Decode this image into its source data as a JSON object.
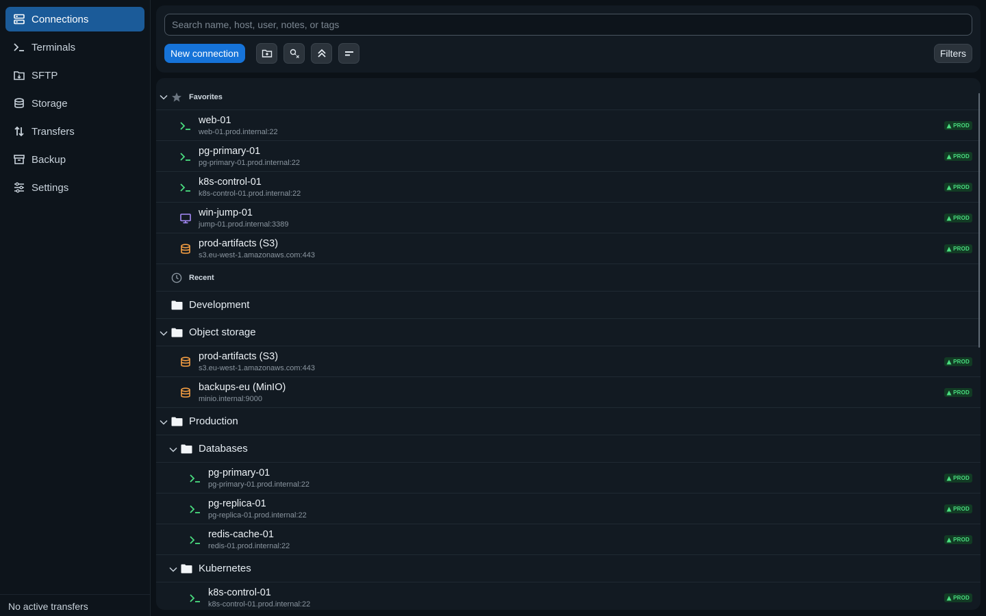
{
  "sidebar": {
    "items": [
      {
        "label": "Connections",
        "icon": "connections-icon",
        "active": true
      },
      {
        "label": "Terminals",
        "icon": "terminal-icon"
      },
      {
        "label": "SFTP",
        "icon": "sftp-icon"
      },
      {
        "label": "Storage",
        "icon": "storage-icon"
      },
      {
        "label": "Transfers",
        "icon": "transfers-icon"
      },
      {
        "label": "Backup",
        "icon": "backup-icon"
      },
      {
        "label": "Settings",
        "icon": "settings-icon"
      }
    ],
    "footer": "No active transfers"
  },
  "toolbar": {
    "search_placeholder": "Search name, host, user, notes, or tags",
    "new_connection": "New connection",
    "filters": "Filters",
    "tools": [
      "new-folder-icon",
      "clear-key-icon",
      "collapse-all-icon",
      "sort-icon"
    ]
  },
  "sections": {
    "favorites": "Favorites",
    "recent": "Recent"
  },
  "favorites": [
    {
      "name": "web-01",
      "host": "web-01.prod.internal:22",
      "type": "ssh",
      "badge": "PROD"
    },
    {
      "name": "pg-primary-01",
      "host": "pg-primary-01.prod.internal:22",
      "type": "ssh",
      "badge": "PROD"
    },
    {
      "name": "k8s-control-01",
      "host": "k8s-control-01.prod.internal:22",
      "type": "ssh",
      "badge": "PROD"
    },
    {
      "name": "win-jump-01",
      "host": "jump-01.prod.internal:3389",
      "type": "rdp",
      "badge": "PROD"
    },
    {
      "name": "prod-artifacts (S3)",
      "host": "s3.eu-west-1.amazonaws.com:443",
      "type": "storage",
      "badge": "PROD"
    }
  ],
  "groups": {
    "development": "Development",
    "object_storage": "Object storage",
    "production": "Production",
    "databases": "Databases",
    "kubernetes": "Kubernetes"
  },
  "object_storage": [
    {
      "name": "prod-artifacts (S3)",
      "host": "s3.eu-west-1.amazonaws.com:443",
      "type": "storage",
      "badge": "PROD"
    },
    {
      "name": "backups-eu (MinIO)",
      "host": "minio.internal:9000",
      "type": "storage",
      "badge": "PROD"
    }
  ],
  "databases": [
    {
      "name": "pg-primary-01",
      "host": "pg-primary-01.prod.internal:22",
      "type": "ssh",
      "badge": "PROD"
    },
    {
      "name": "pg-replica-01",
      "host": "pg-replica-01.prod.internal:22",
      "type": "ssh",
      "badge": "PROD"
    },
    {
      "name": "redis-cache-01",
      "host": "redis-01.prod.internal:22",
      "type": "ssh",
      "badge": "PROD"
    }
  ],
  "kubernetes": [
    {
      "name": "k8s-control-01",
      "host": "k8s-control-01.prod.internal:22",
      "type": "ssh",
      "badge": "PROD"
    }
  ],
  "colors": {
    "accent": "#1b5b99",
    "button": "#1673d8",
    "ssh": "#4ade80",
    "rdp": "#a78bfa",
    "storage": "#f59e42",
    "badge_bg": "#123b24",
    "badge_fg": "#4ade80"
  }
}
